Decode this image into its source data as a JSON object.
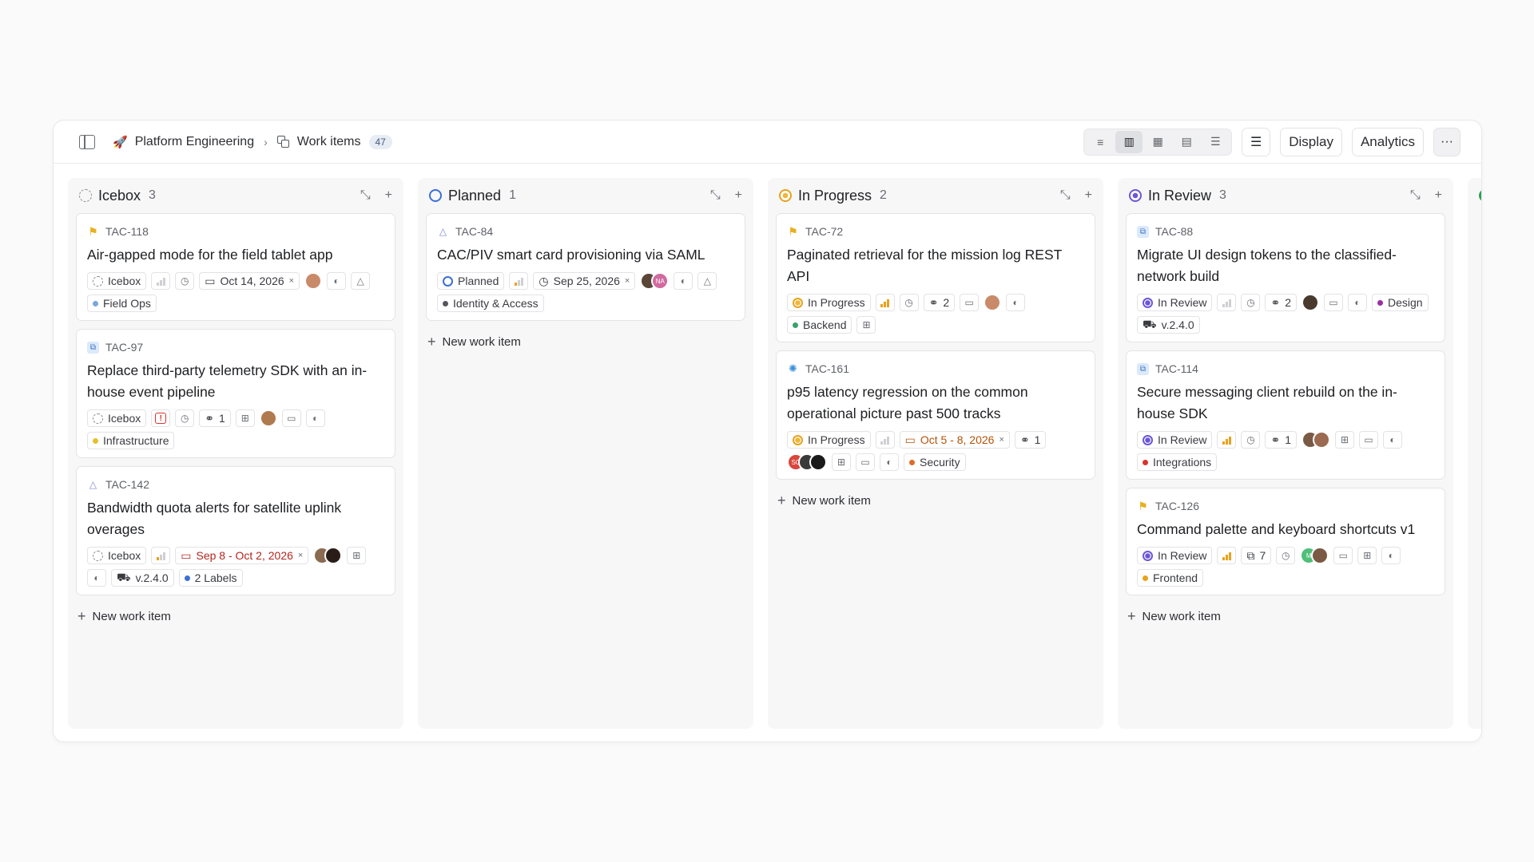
{
  "header": {
    "project": "Platform Engineering",
    "section": "Work items",
    "count": "47",
    "display_label": "Display",
    "analytics_label": "Analytics"
  },
  "colors": {
    "accent": "#3b6fd6",
    "planned": "#3b6fd6",
    "in_progress": "#e8a21d",
    "in_review": "#6c56d8",
    "done": "#2e9d54",
    "urgent": "#d9342b"
  },
  "new_item_label": "New work item",
  "columns": [
    {
      "title": "Icebox",
      "count": "3",
      "cards": [
        {
          "id": "TAC-118",
          "title": "Air-gapped mode for the field tablet app",
          "state": "Icebox",
          "date": "Oct 14, 2026",
          "label": "Field Ops"
        },
        {
          "id": "TAC-97",
          "title": "Replace third-party telemetry SDK with an in-house event pipeline",
          "state": "Icebox",
          "links": "1",
          "label": "Infrastructure"
        },
        {
          "id": "TAC-142",
          "title": "Bandwidth quota alerts for satellite uplink overages",
          "state": "Icebox",
          "date": "Sep 8 - Oct 2, 2026",
          "release": "v.2.4.0",
          "label": "2 Labels"
        }
      ]
    },
    {
      "title": "Planned",
      "count": "1",
      "cards": [
        {
          "id": "TAC-84",
          "title": "CAC/PIV smart card provisioning via SAML",
          "state": "Planned",
          "date": "Sep 25, 2026",
          "avatar2": "NA",
          "label": "Identity & Access"
        }
      ]
    },
    {
      "title": "In Progress",
      "count": "2",
      "cards": [
        {
          "id": "TAC-72",
          "title": "Paginated retrieval for the mission log REST API",
          "state": "In Progress",
          "links": "2",
          "label": "Backend"
        },
        {
          "id": "TAC-161",
          "title": "p95 latency regression on the common operational picture past 500 tracks",
          "state": "In Progress",
          "date": "Oct 5 - 8, 2026",
          "links": "1",
          "avatar1": "SC",
          "label": "Security"
        }
      ]
    },
    {
      "title": "In Review",
      "count": "3",
      "cards": [
        {
          "id": "TAC-88",
          "title": "Migrate UI design tokens to the classified-network build",
          "state": "In Review",
          "links": "2",
          "label": "Design",
          "release": "v.2.4.0"
        },
        {
          "id": "TAC-114",
          "title": "Secure messaging client rebuild on the in-house SDK",
          "state": "In Review",
          "links": "1",
          "label": "Integrations"
        },
        {
          "id": "TAC-126",
          "title": "Command palette and keyboard shortcuts v1",
          "state": "In Review",
          "subs": "7",
          "avatar1": "M",
          "label": "Frontend"
        }
      ]
    }
  ]
}
